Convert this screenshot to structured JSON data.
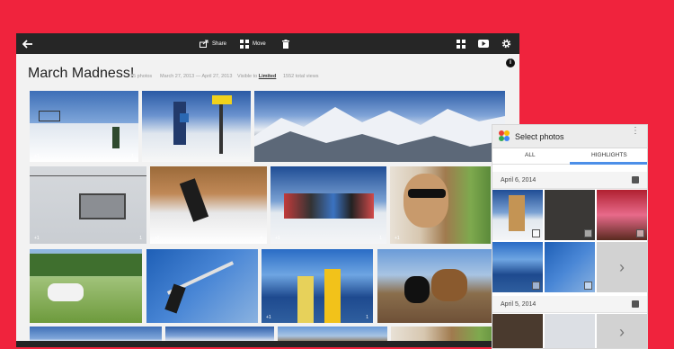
{
  "toolbar": {
    "back_icon": "arrow-left-icon",
    "share_label": "Share",
    "move_label": "Move",
    "delete_icon": "trash-icon",
    "icons_right": [
      "grid-icon",
      "play-icon",
      "gear-icon"
    ]
  },
  "album": {
    "title": "March Madness!",
    "photo_count": "15 photos",
    "date_range": "March 27, 2013 — April 27, 2013",
    "visibility_prefix": "Visible to",
    "visibility_value": "Limited",
    "views": "1552 total views",
    "info_icon": "info-icon"
  },
  "photos": [
    {
      "row": 1,
      "plus_count": "+1",
      "comments": "1"
    },
    {
      "row": 1,
      "plus_count": "",
      "comments": ""
    },
    {
      "row": 1,
      "plus_count": "",
      "comments": ""
    },
    {
      "row": 2,
      "plus_count": "+1",
      "comments": "1"
    },
    {
      "row": 2,
      "plus_count": "+2",
      "comments": "4"
    },
    {
      "row": 2,
      "plus_count": "+1",
      "comments": "1"
    },
    {
      "row": 2,
      "plus_count": "+1",
      "comments": ""
    },
    {
      "row": 3,
      "plus_count": "",
      "comments": ""
    },
    {
      "row": 3,
      "plus_count": "",
      "comments": ""
    },
    {
      "row": 3,
      "plus_count": "+1",
      "comments": "1"
    },
    {
      "row": 3,
      "plus_count": "",
      "comments": ""
    }
  ],
  "picker": {
    "title": "Select photos",
    "menu_icon": "more-vert-icon",
    "tabs": [
      "ALL",
      "HIGHLIGHTS"
    ],
    "active_tab": "HIGHLIGHTS",
    "groups": [
      {
        "date": "April 6, 2014"
      },
      {
        "date": "April 5, 2014"
      }
    ],
    "more_icon": "chevron-right-icon"
  },
  "colors": {
    "background": "#f0233d",
    "toolbar": "#262626",
    "tab_accent": "#4c8fe8"
  }
}
